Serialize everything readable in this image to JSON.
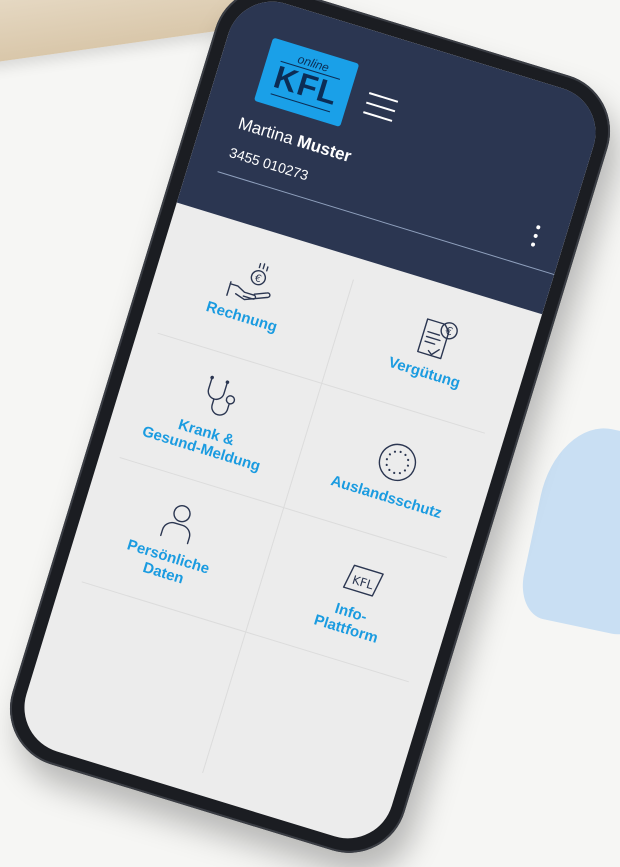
{
  "app": {
    "logo_online": "online",
    "logo_text": "KFL",
    "user_first_name": "Martina",
    "user_last_name": "Muster",
    "member_number": "3455 010273"
  },
  "icons": {
    "menu": "hamburger-menu-icon",
    "more": "more-vertical-icon"
  },
  "tiles": [
    {
      "label": "Rechnung",
      "icon": "coin-hand-icon"
    },
    {
      "label": "Vergütung",
      "icon": "invoice-euro-icon"
    },
    {
      "label": "Krank &\nGesund-Meldung",
      "icon": "stethoscope-icon"
    },
    {
      "label": "Auslandsschutz",
      "icon": "eu-stars-icon"
    },
    {
      "label": "Persönliche\nDaten",
      "icon": "person-icon"
    },
    {
      "label": "Info-\nPlattform",
      "icon": "kfl-platform-icon"
    }
  ],
  "colors": {
    "header_bg": "#2b3651",
    "logo_bg": "#1aa0e8",
    "label_accent": "#1a9be0"
  }
}
